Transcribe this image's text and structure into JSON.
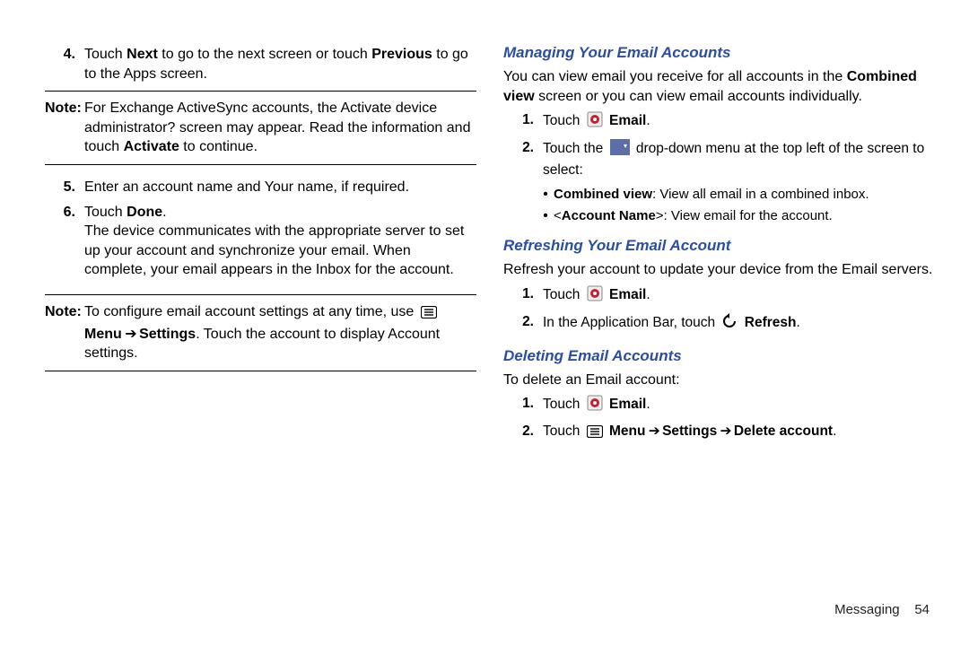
{
  "left": {
    "step4_a": "Touch ",
    "step4_b": "Next",
    "step4_c": " to go to the next screen or touch ",
    "step4_d": "Previous",
    "step4_e": " to go to the Apps screen.",
    "note1_label": "Note:",
    "note1_a": " For Exchange ActiveSync accounts, the Activate device administrator? screen may appear. Read the information and touch ",
    "note1_b": "Activate",
    "note1_c": " to continue.",
    "step5": "Enter an account name and Your name, if required.",
    "step6_a": "Touch ",
    "step6_b": "Done",
    "step6_c": ".",
    "step6_d": "The device communicates with the appropriate server to set up your account and synchronize your email. When complete, your email appears in the Inbox for the account.",
    "note2_label": "Note:",
    "note2_a": " To configure email account settings at any time, use ",
    "note2_menu": "Menu",
    "note2_arrow": " ➔ ",
    "note2_settings": "Settings",
    "note2_b": ". Touch the account to display Account settings."
  },
  "right": {
    "h1": "Managing Your Email Accounts",
    "p1_a": "You can view email you receive for all accounts in the ",
    "p1_b": "Combined view",
    "p1_c": " screen or you can view email accounts individually.",
    "r1_a": "Touch ",
    "r1_email": "Email",
    "r1_dot": ".",
    "r2_a": "Touch the ",
    "r2_b": " drop-down menu at the top left of the screen to select:",
    "bul1_a": "Combined view",
    "bul1_b": ": View all email in a combined inbox.",
    "bul2_a": "<",
    "bul2_b": "Account Name",
    "bul2_c": ">: View email for the account.",
    "h2": "Refreshing Your Email Account",
    "p2": "Refresh your account to update your device from the Email servers.",
    "r3_a": "Touch ",
    "r3_email": "Email",
    "r3_dot": ".",
    "r4_a": "In the Application Bar, touch ",
    "r4_refresh": "Refresh",
    "r4_dot": ".",
    "h3": "Deleting Email Accounts",
    "p3": "To delete an Email account:",
    "r5_a": "Touch ",
    "r5_email": "Email",
    "r5_dot": ".",
    "r6_a": "Touch ",
    "r6_menu": "Menu",
    "r6_arr1": " ➔ ",
    "r6_settings": "Settings",
    "r6_arr2": " ➔ ",
    "r6_del": "Delete account",
    "r6_dot": "."
  },
  "footer": {
    "section": "Messaging",
    "page": "54"
  }
}
